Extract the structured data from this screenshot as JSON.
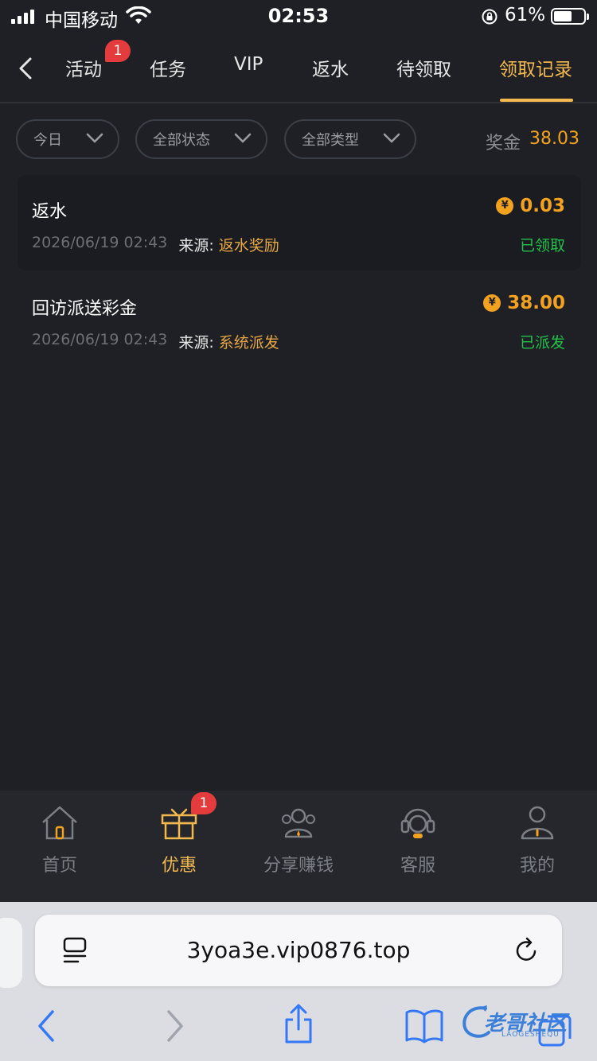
{
  "status_bar": {
    "carrier": "中国移动",
    "time": "02:53",
    "battery_pct": "61%",
    "battery_level": 0.61
  },
  "topnav": {
    "tabs": [
      {
        "label": "活动"
      },
      {
        "label": "任务"
      },
      {
        "label": "VIP"
      },
      {
        "label": "返水"
      },
      {
        "label": "待领取"
      },
      {
        "label": "领取记录"
      }
    ],
    "activity_badge": "1",
    "active_tab": "领取记录"
  },
  "filters": {
    "date": "今日",
    "status": "全部状态",
    "type": "全部类型",
    "bonus_label": "奖金",
    "bonus_value": "38.03"
  },
  "records": [
    {
      "title": "返水",
      "coin": "¥",
      "amount": "0.03",
      "datetime": "2026/06/19 02:43",
      "source_label": "来源:",
      "source": "返水奖励",
      "status": "已领取"
    },
    {
      "title": "回访派送彩金",
      "coin": "¥",
      "amount": "38.00",
      "datetime": "2026/06/19 02:43",
      "source_label": "来源:",
      "source": "系统派发",
      "status": "已派发"
    }
  ],
  "bottomnav": {
    "items": [
      {
        "label": "首页",
        "icon": "home-icon"
      },
      {
        "label": "优惠",
        "icon": "gift-icon"
      },
      {
        "label": "分享赚钱",
        "icon": "share-people-icon"
      },
      {
        "label": "客服",
        "icon": "headset-icon"
      },
      {
        "label": "我的",
        "icon": "user-icon"
      }
    ],
    "active": "优惠",
    "promo_badge": "1"
  },
  "browser": {
    "url": "3yoa3e.vip0876.top"
  },
  "watermark": {
    "text": "老哥社区",
    "sub": "LAOGESHEQU"
  },
  "colors": {
    "accent": "#f3b84e",
    "amount": "#f3a21f",
    "success": "#23c14a",
    "badge": "#e43c3c",
    "background": "#1e2025"
  }
}
